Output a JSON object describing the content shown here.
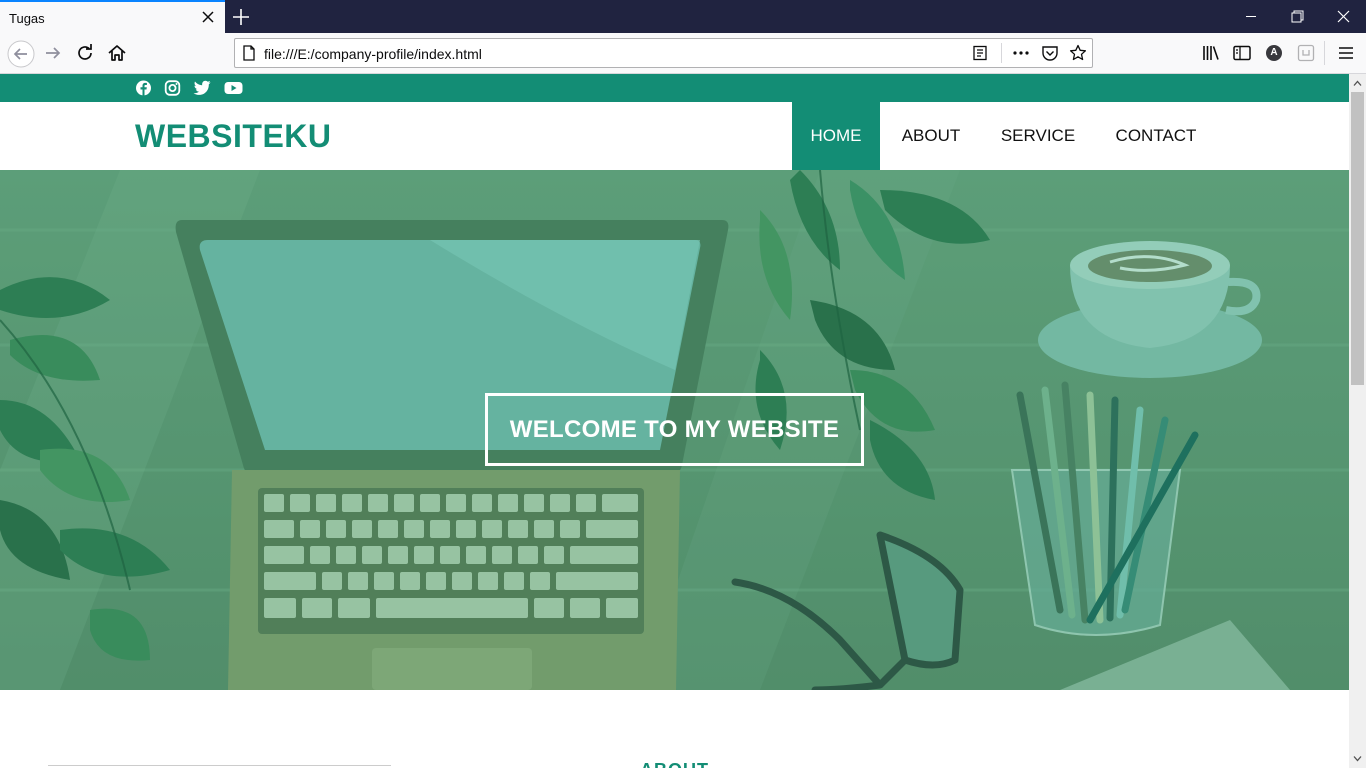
{
  "browser": {
    "tab_title": "Tugas",
    "url": "file:///E:/company-profile/index.html",
    "profile_initial": "A"
  },
  "site": {
    "brand": "WEBSITEKU",
    "social_icons": [
      "facebook-icon",
      "instagram-icon",
      "twitter-icon",
      "youtube-icon"
    ],
    "nav": {
      "home": "HOME",
      "about": "ABOUT",
      "service": "SERVICE",
      "contact": "CONTACT",
      "active": "HOME"
    },
    "hero": {
      "title": "WELCOME TO MY WEBSITE"
    },
    "next_section_heading": "ABOUT"
  },
  "colors": {
    "primary": "#138d75",
    "hero_tint": "#5f9a72",
    "tabbar": "#202340"
  }
}
